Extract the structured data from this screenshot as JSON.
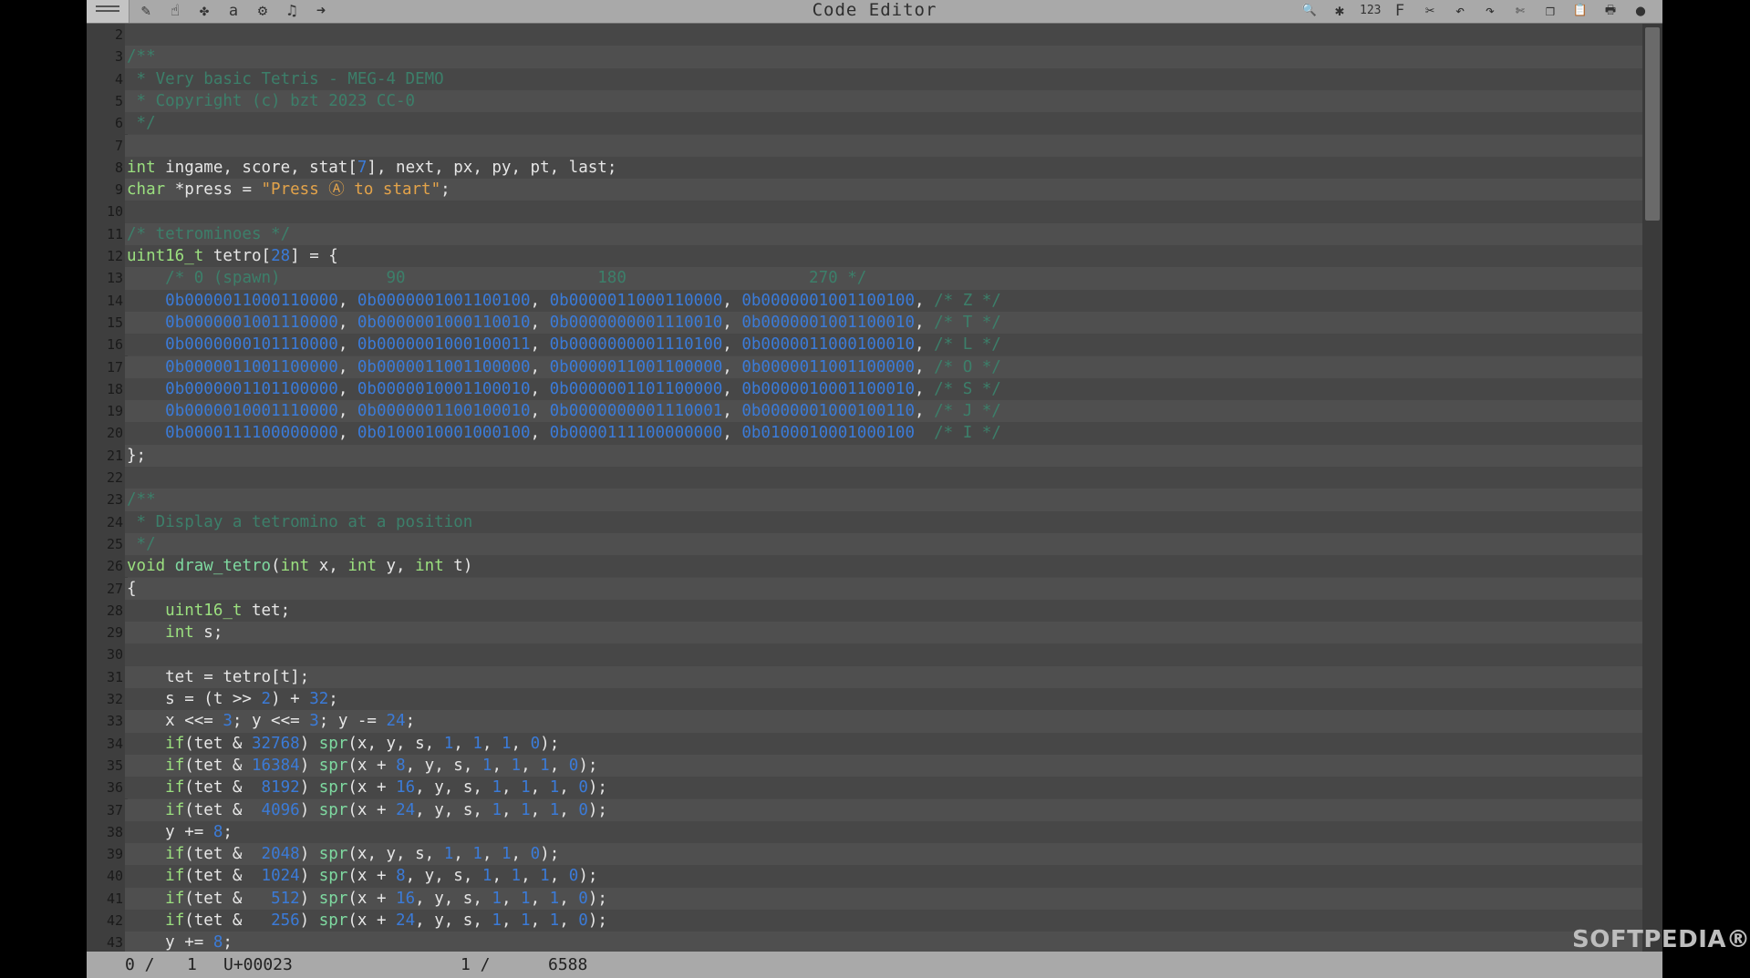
{
  "window": {
    "title": "Code Editor"
  },
  "toolbar": {
    "left_icons": [
      "menu-icon",
      "pencil-icon",
      "hand-icon",
      "puzzle-icon",
      "font-a-icon",
      "gear-icon",
      "music-note-icon",
      "arrow-right-icon"
    ],
    "left_glyphs": [
      "✎",
      "☝",
      "✤",
      "a",
      "⚙",
      "♫",
      "➜"
    ],
    "right_icons": [
      "search-icon",
      "bug-icon",
      "numbers-icon",
      "letter-f-icon",
      "pin-icon",
      "undo-icon",
      "redo-icon",
      "cut-icon",
      "copy-icon",
      "paste-icon",
      "print-icon",
      "help-icon"
    ],
    "right_glyphs": [
      "🔍",
      "✱",
      "123",
      "F",
      "✂",
      "↶",
      "↷",
      "✄",
      "❐",
      "📋",
      "🖶",
      "●"
    ]
  },
  "editor": {
    "lines": [
      {
        "n": "2",
        "html": ""
      },
      {
        "n": "3",
        "html": "<span class='cm'>/**</span>"
      },
      {
        "n": "4",
        "html": "<span class='cm'> * Very basic Tetris - MEG-4 DEMO</span>"
      },
      {
        "n": "5",
        "html": "<span class='cm'> * Copyright (c) bzt 2023 CC-0</span>"
      },
      {
        "n": "6",
        "html": "<span class='cm'> */</span>"
      },
      {
        "n": "7",
        "html": ""
      },
      {
        "n": "8",
        "html": "<span class='kw'>int</span> ingame, score, stat[<span class='num'>7</span>], next, px, py, pt, last;"
      },
      {
        "n": "9",
        "html": "<span class='kw'>char</span> *press = <span class='str'>\"Press Ⓐ to start\"</span>;"
      },
      {
        "n": "10",
        "html": ""
      },
      {
        "n": "11",
        "html": "<span class='cm'>/* tetrominoes */</span>"
      },
      {
        "n": "12",
        "html": "<span class='kw'>uint16_t</span> tetro[<span class='num'>28</span>] = {"
      },
      {
        "n": "13",
        "html": "    <span class='cm'>/* 0 (spawn)           90                    180                   270 */</span>"
      },
      {
        "n": "14",
        "html": "    <span class='num'>0b0000011000110000</span>, <span class='num'>0b0000001001100100</span>, <span class='num'>0b0000011000110000</span>, <span class='num'>0b0000001001100100</span>, <span class='cm'>/* Z */</span>"
      },
      {
        "n": "15",
        "html": "    <span class='num'>0b0000001001110000</span>, <span class='num'>0b0000001000110010</span>, <span class='num'>0b0000000001110010</span>, <span class='num'>0b0000001001100010</span>, <span class='cm'>/* T */</span>"
      },
      {
        "n": "16",
        "html": "    <span class='num'>0b0000000101110000</span>, <span class='num'>0b0000001000100011</span>, <span class='num'>0b0000000001110100</span>, <span class='num'>0b0000011000100010</span>, <span class='cm'>/* L */</span>"
      },
      {
        "n": "17",
        "html": "    <span class='num'>0b0000011001100000</span>, <span class='num'>0b0000011001100000</span>, <span class='num'>0b0000011001100000</span>, <span class='num'>0b0000011001100000</span>, <span class='cm'>/* O */</span>"
      },
      {
        "n": "18",
        "html": "    <span class='num'>0b0000001101100000</span>, <span class='num'>0b0000010001100010</span>, <span class='num'>0b0000001101100000</span>, <span class='num'>0b0000010001100010</span>, <span class='cm'>/* S */</span>"
      },
      {
        "n": "19",
        "html": "    <span class='num'>0b0000010001110000</span>, <span class='num'>0b0000001100100010</span>, <span class='num'>0b0000000001110001</span>, <span class='num'>0b0000001000100110</span>, <span class='cm'>/* J */</span>"
      },
      {
        "n": "20",
        "html": "    <span class='num'>0b0000111100000000</span>, <span class='num'>0b0100010001000100</span>, <span class='num'>0b0000111100000000</span>, <span class='num'>0b0100010001000100</span>  <span class='cm'>/* I */</span>"
      },
      {
        "n": "21",
        "html": "};"
      },
      {
        "n": "22",
        "html": ""
      },
      {
        "n": "23",
        "html": "<span class='cm'>/**</span>"
      },
      {
        "n": "24",
        "html": "<span class='cm'> * Display a tetromino at a position</span>"
      },
      {
        "n": "25",
        "html": "<span class='cm'> */</span>"
      },
      {
        "n": "26",
        "html": "<span class='kw'>void</span> <span class='fn'>draw_tetro</span>(<span class='kw'>int</span> x, <span class='kw'>int</span> y, <span class='kw'>int</span> t)"
      },
      {
        "n": "27",
        "html": "{"
      },
      {
        "n": "28",
        "html": "    <span class='kw'>uint16_t</span> tet;"
      },
      {
        "n": "29",
        "html": "    <span class='kw'>int</span> s;"
      },
      {
        "n": "30",
        "html": ""
      },
      {
        "n": "31",
        "html": "    tet = tetro[t];"
      },
      {
        "n": "32",
        "html": "    s = (t >> <span class='num'>2</span>) + <span class='num'>32</span>;"
      },
      {
        "n": "33",
        "html": "    x <<= <span class='num'>3</span>; y <<= <span class='num'>3</span>; y -= <span class='num'>24</span>;"
      },
      {
        "n": "34",
        "html": "    <span class='kw'>if</span>(tet & <span class='num'>32768</span>) <span class='fn'>spr</span>(x, y, s, <span class='num'>1</span>, <span class='num'>1</span>, <span class='num'>1</span>, <span class='num'>0</span>);"
      },
      {
        "n": "35",
        "html": "    <span class='kw'>if</span>(tet & <span class='num'>16384</span>) <span class='fn'>spr</span>(x + <span class='num'>8</span>, y, s, <span class='num'>1</span>, <span class='num'>1</span>, <span class='num'>1</span>, <span class='num'>0</span>);"
      },
      {
        "n": "36",
        "html": "    <span class='kw'>if</span>(tet &  <span class='num'>8192</span>) <span class='fn'>spr</span>(x + <span class='num'>16</span>, y, s, <span class='num'>1</span>, <span class='num'>1</span>, <span class='num'>1</span>, <span class='num'>0</span>);"
      },
      {
        "n": "37",
        "html": "    <span class='kw'>if</span>(tet &  <span class='num'>4096</span>) <span class='fn'>spr</span>(x + <span class='num'>24</span>, y, s, <span class='num'>1</span>, <span class='num'>1</span>, <span class='num'>1</span>, <span class='num'>0</span>);"
      },
      {
        "n": "38",
        "html": "    y += <span class='num'>8</span>;"
      },
      {
        "n": "39",
        "html": "    <span class='kw'>if</span>(tet &  <span class='num'>2048</span>) <span class='fn'>spr</span>(x, y, s, <span class='num'>1</span>, <span class='num'>1</span>, <span class='num'>1</span>, <span class='num'>0</span>);"
      },
      {
        "n": "40",
        "html": "    <span class='kw'>if</span>(tet &  <span class='num'>1024</span>) <span class='fn'>spr</span>(x + <span class='num'>8</span>, y, s, <span class='num'>1</span>, <span class='num'>1</span>, <span class='num'>1</span>, <span class='num'>0</span>);"
      },
      {
        "n": "41",
        "html": "    <span class='kw'>if</span>(tet &   <span class='num'>512</span>) <span class='fn'>spr</span>(x + <span class='num'>16</span>, y, s, <span class='num'>1</span>, <span class='num'>1</span>, <span class='num'>1</span>, <span class='num'>0</span>);"
      },
      {
        "n": "42",
        "html": "    <span class='kw'>if</span>(tet &   <span class='num'>256</span>) <span class='fn'>spr</span>(x + <span class='num'>24</span>, y, s, <span class='num'>1</span>, <span class='num'>1</span>, <span class='num'>1</span>, <span class='num'>0</span>);"
      },
      {
        "n": "43",
        "html": "    y += <span class='num'>8</span>;"
      }
    ]
  },
  "statusbar": {
    "line_current": "0 /",
    "line_total": "1",
    "unicode": "U+00023",
    "pos_current": "1 /",
    "pos_total": "6588"
  },
  "watermark": "SOFTPEDIA®"
}
